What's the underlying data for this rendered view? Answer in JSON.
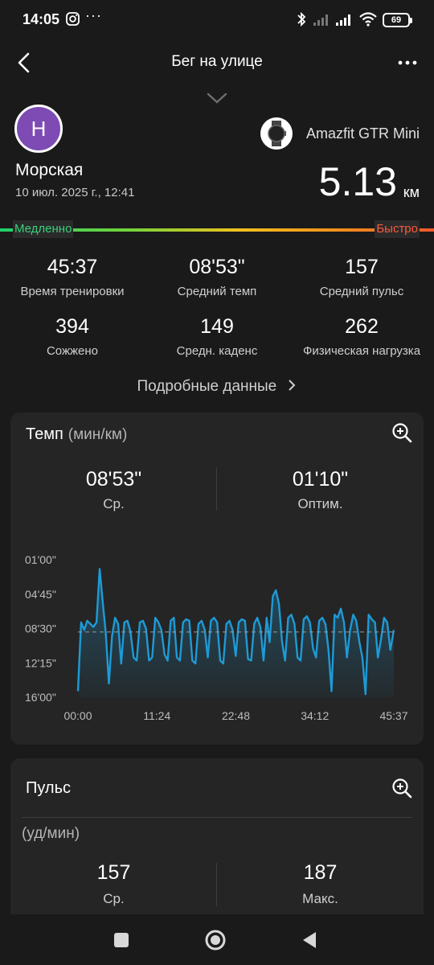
{
  "status": {
    "time": "14:05",
    "dots": "···",
    "battery": "69"
  },
  "header": {
    "title": "Бег на улице"
  },
  "profile": {
    "avatar_letter": "Н",
    "name": "Морская",
    "date": "10 июл. 2025 г., 12:41"
  },
  "device": {
    "name": "Amazfit GTR Mini"
  },
  "distance": {
    "value": "5.13",
    "unit": "км"
  },
  "pace_scale": {
    "slow": "Медленно",
    "fast": "Быстро"
  },
  "stats": [
    {
      "value": "45:37",
      "label": "Время тренировки"
    },
    {
      "value": "08'53\"",
      "label": "Средний темп"
    },
    {
      "value": "157",
      "label": "Средний пульс"
    },
    {
      "value": "394",
      "label": "Сожжено"
    },
    {
      "value": "149",
      "label": "Средн. каденс"
    },
    {
      "value": "262",
      "label": "Физическая нагрузка"
    }
  ],
  "details_link": "Подробные данные",
  "pace_card": {
    "title": "Темп",
    "unit": "(мин/км)",
    "avg_value": "08'53\"",
    "avg_label": "Ср.",
    "best_value": "01'10\"",
    "best_label": "Оптим."
  },
  "hr_card": {
    "title": "Пульс",
    "unit": "(уд/мин)",
    "avg_value": "157",
    "avg_label": "Ср.",
    "max_value": "187",
    "max_label": "Макс."
  },
  "colors": {
    "accent": "#1e9ad6",
    "card": "#252525",
    "background": "#1a1a1a",
    "avatar": "#7d4bb3"
  },
  "chart_data": {
    "type": "area",
    "title": "Темп",
    "ylabel": "(мин/км)",
    "y_ticks": [
      "01'00\"",
      "04'45\"",
      "08'30\"",
      "12'15\"",
      "16'00\""
    ],
    "x_ticks": [
      "00:00",
      "11:24",
      "22:48",
      "34:12",
      "45:37"
    ],
    "y_range_seconds": [
      60,
      960
    ],
    "y_inverted": true,
    "x_range_seconds": [
      0,
      2737
    ],
    "avg_line_seconds": 533,
    "series": [
      {
        "x": [
          0,
          27,
          54,
          80,
          107,
          134,
          161,
          188,
          214,
          241,
          268,
          295,
          322,
          348,
          375,
          402,
          429,
          455,
          482,
          509,
          536,
          563,
          589,
          616,
          643,
          670,
          697,
          723,
          750,
          777,
          804,
          831,
          857,
          884,
          911,
          938,
          965,
          991,
          1018,
          1045,
          1072,
          1099,
          1125,
          1152,
          1179,
          1206,
          1233,
          1259,
          1286,
          1313,
          1340,
          1367,
          1393,
          1420,
          1447,
          1474,
          1501,
          1527,
          1554,
          1581,
          1608,
          1635,
          1661,
          1688,
          1715,
          1742,
          1769,
          1795,
          1822,
          1849,
          1876,
          1903,
          1929,
          1956,
          1983,
          2010,
          2037,
          2063,
          2090,
          2117,
          2144,
          2171,
          2197,
          2224,
          2251,
          2278,
          2305,
          2331,
          2358,
          2385,
          2412,
          2439,
          2465,
          2492,
          2519,
          2546,
          2573,
          2599,
          2626,
          2653,
          2680,
          2707,
          2737
        ],
        "values": [
          920,
          470,
          520,
          460,
          480,
          500,
          470,
          120,
          330,
          540,
          870,
          560,
          440,
          480,
          740,
          470,
          460,
          530,
          700,
          720,
          470,
          460,
          510,
          720,
          700,
          440,
          470,
          520,
          680,
          720,
          460,
          440,
          700,
          720,
          470,
          450,
          460,
          720,
          740,
          480,
          460,
          520,
          700,
          460,
          440,
          470,
          720,
          740,
          480,
          460,
          520,
          690,
          470,
          450,
          460,
          710,
          720,
          480,
          440,
          500,
          720,
          440,
          600,
          300,
          260,
          350,
          600,
          720,
          440,
          420,
          480,
          700,
          720,
          450,
          430,
          470,
          640,
          700,
          460,
          440,
          480,
          650,
          920,
          420,
          440,
          380,
          470,
          700,
          520,
          420,
          460,
          600,
          700,
          940,
          420,
          450,
          470,
          700,
          580,
          440,
          470,
          650,
          520
        ]
      }
    ]
  }
}
